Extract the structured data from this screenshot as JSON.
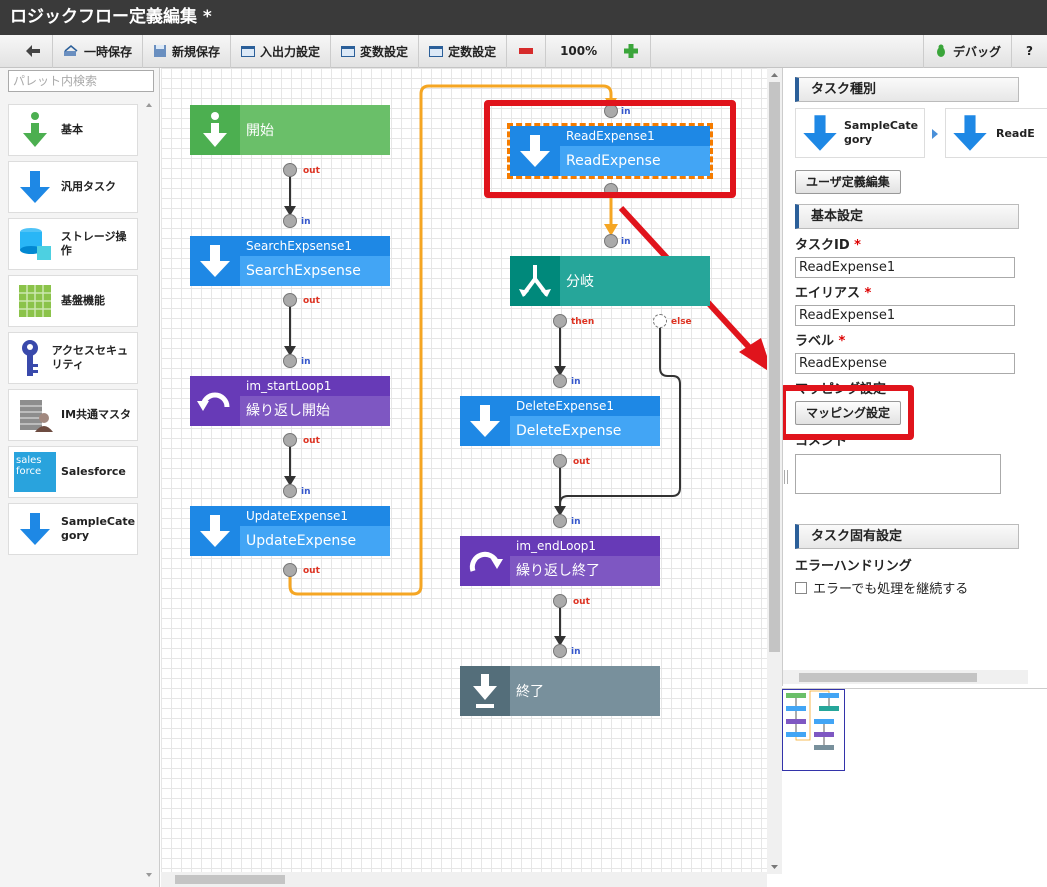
{
  "window": {
    "title": "ロジックフロー定義編集 *"
  },
  "toolbar": {
    "back_icon": "arrow-left-icon",
    "temp_save": "一時保存",
    "new_save": "新規保存",
    "io_settings": "入出力設定",
    "var_settings": "変数設定",
    "const_settings": "定数設定",
    "zoom": "100%",
    "debug": "デバッグ",
    "help": "?"
  },
  "palette": {
    "search_placeholder": "パレット内検索",
    "items": [
      {
        "label": "基本",
        "icon": "start-arrow-icon"
      },
      {
        "label": "汎用タスク",
        "icon": "down-arrow-icon"
      },
      {
        "label": "ストレージ操作",
        "icon": "database-icon"
      },
      {
        "label": "基盤機能",
        "icon": "grid-icon"
      },
      {
        "label": "アクセスセキュリティ",
        "icon": "key-icon"
      },
      {
        "label": "IM共通マスタ",
        "icon": "building-user-icon"
      },
      {
        "label": "Salesforce",
        "icon": "salesforce-icon"
      },
      {
        "label": "SampleCategory",
        "icon": "down-arrow-icon"
      }
    ],
    "salesforce_logo": "sales force"
  },
  "flow": {
    "start": {
      "label": "開始"
    },
    "search": {
      "id": "SearchExpsense1",
      "label": "SearchExpsense"
    },
    "loop_start": {
      "id": "im_startLoop1",
      "label": "繰り返し開始"
    },
    "update": {
      "id": "UpdateExpense1",
      "label": "UpdateExpense"
    },
    "read": {
      "id": "ReadExpense1",
      "label": "ReadExpense"
    },
    "branch": {
      "label": "分岐"
    },
    "delete": {
      "id": "DeleteExpense1",
      "label": "DeleteExpense"
    },
    "loop_end": {
      "id": "im_endLoop1",
      "label": "繰り返し終了"
    },
    "end": {
      "label": "終了"
    },
    "port_in": "in",
    "port_out": "out",
    "port_then": "then",
    "port_else": "else"
  },
  "props": {
    "task_type_header": "タスク種別",
    "breadcrumb_1": "SampleCategory",
    "breadcrumb_2": "ReadE",
    "user_def_edit": "ユーザ定義編集",
    "basic_header": "基本設定",
    "task_id_label": "タスクID",
    "task_id_value": "ReadExpense1",
    "alias_label": "エイリアス",
    "alias_value": "ReadExpense1",
    "label_label": "ラベル",
    "label_value": "ReadExpense",
    "mapping_label_partial": "マッピング設定",
    "mapping_button": "マッピング設定",
    "comment_label": "コメント",
    "comment_value": "",
    "specific_header": "タスク固有設定",
    "error_handling_label": "エラーハンドリング",
    "continue_on_error": "エラーでも処理を継続する",
    "required_mark": "*"
  },
  "colors": {
    "blue_dark": "#1e88e5",
    "blue_light": "#42a5f5",
    "green": "#6abf69",
    "green_dark": "#4caf50",
    "purple": "#7e57c2",
    "purple_dark": "#673ab7",
    "teal": "#26a69a",
    "teal_dark": "#00897b",
    "gray": "#78909c",
    "gray_dark": "#546e7a",
    "orange_line": "#f5a623",
    "highlight_red": "#e0141c"
  }
}
